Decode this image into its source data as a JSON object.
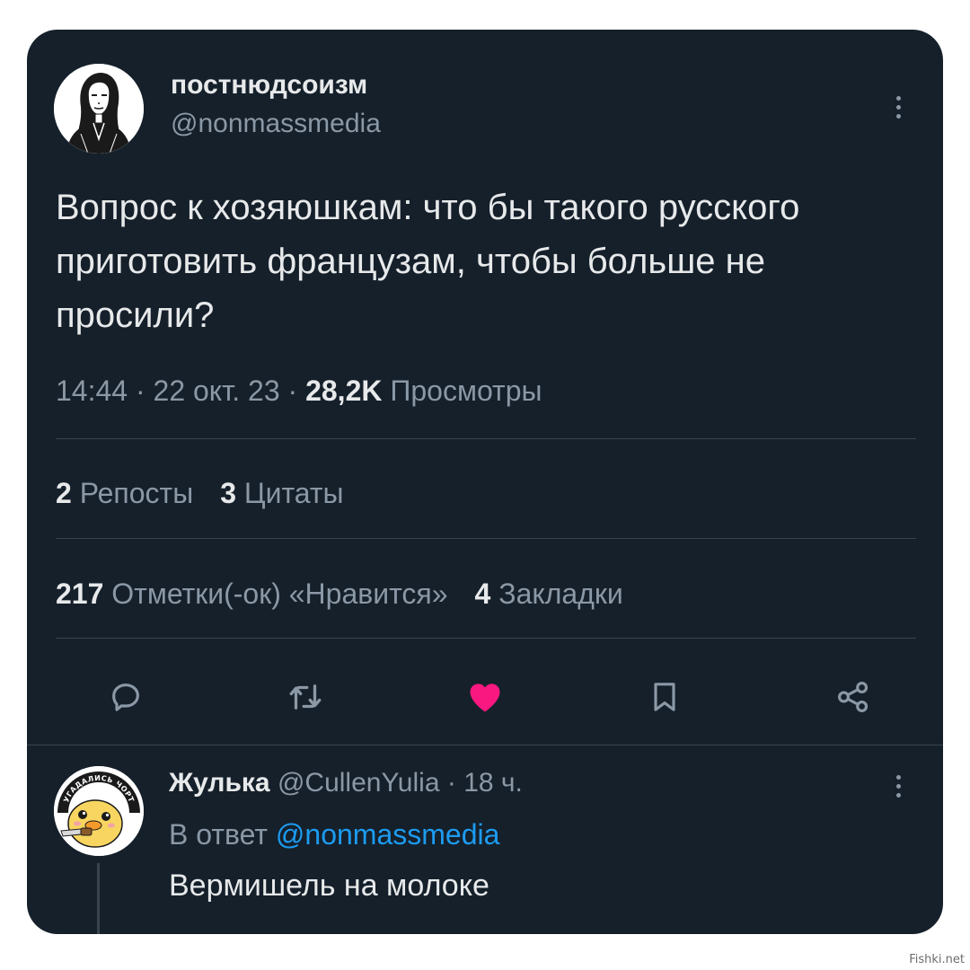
{
  "tweet": {
    "author": {
      "display_name": "постнюдсоизм",
      "handle": "@nonmassmedia"
    },
    "text": "Вопрос к хозяюшкам: что бы такого русского приготовить французам, чтобы больше не просили?",
    "meta": {
      "time": "14:44",
      "separator": " · ",
      "date": "22 окт. 23",
      "views_count": "28,2K",
      "views_label": "Просмотры"
    },
    "stats": {
      "reposts_count": "2",
      "reposts_label": "Репосты",
      "quotes_count": "3",
      "quotes_label": "Цитаты",
      "likes_count": "217",
      "likes_label": "Отметки(-ок) «Нравится»",
      "bookmarks_count": "4",
      "bookmarks_label": "Закладки"
    },
    "actions": [
      {
        "icon": "reply-icon"
      },
      {
        "icon": "retweet-icon"
      },
      {
        "icon": "heart-icon",
        "active": true,
        "color": "#f91880"
      },
      {
        "icon": "bookmark-icon"
      },
      {
        "icon": "share-icon"
      }
    ]
  },
  "reply": {
    "author": {
      "display_name": "Жулька",
      "handle": "@CullenYulia",
      "separator": " · ",
      "time_ago": "18 ч."
    },
    "in_reply_to_label": "В ответ",
    "in_reply_to_handle": "@nonmassmedia",
    "text": "Вермишель на молоке",
    "avatar_caption": "УГАДАЛИСЬ ЧОРТ"
  },
  "watermark": "Fishki.net",
  "colors": {
    "background": "#15202b",
    "text_primary": "#e7e9ea",
    "text_secondary": "#8b98a5",
    "link": "#1d9bf0",
    "like": "#f91880",
    "divider": "#38444d"
  }
}
